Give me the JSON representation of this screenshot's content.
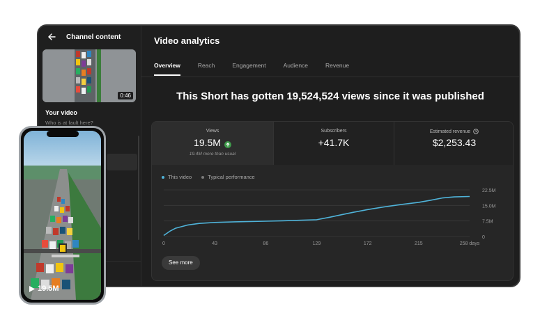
{
  "sidebar": {
    "title": "Channel content",
    "thumbnail_duration": "0:46",
    "your_video_label": "Your video",
    "video_title": "Who is at fault here?"
  },
  "main": {
    "title": "Video analytics",
    "tabs": [
      {
        "label": "Overview",
        "active": true
      },
      {
        "label": "Reach",
        "active": false
      },
      {
        "label": "Engagement",
        "active": false
      },
      {
        "label": "Audience",
        "active": false
      },
      {
        "label": "Revenue",
        "active": false
      }
    ],
    "headline": "This Short has gotten 19,524,524 views since it was published",
    "cards": {
      "views": {
        "label": "Views",
        "value": "19.5M",
        "note": "19.4M more than usual"
      },
      "subscribers": {
        "label": "Subscribers",
        "value": "+41.7K"
      },
      "revenue": {
        "label": "Estimated revenue",
        "value": "$2,253.43"
      }
    },
    "see_more_label": "See more"
  },
  "phone": {
    "views_label": "19.5M"
  },
  "colors": {
    "accent_line": "#4fb3d9",
    "typical_line": "#7a7a7a",
    "up_badge": "#3f9b4b"
  },
  "chart_data": {
    "type": "line",
    "series": [
      {
        "name": "This video",
        "x": [
          0,
          5,
          10,
          20,
          30,
          43,
          60,
          86,
          100,
          129,
          140,
          150,
          160,
          172,
          185,
          200,
          215,
          225,
          235,
          245,
          258
        ],
        "y": [
          0.5,
          2.5,
          4.0,
          5.5,
          6.3,
          6.8,
          7.1,
          7.4,
          7.6,
          8.1,
          9.3,
          10.5,
          11.7,
          13.0,
          14.2,
          15.4,
          16.5,
          17.5,
          18.6,
          19.1,
          19.3
        ]
      }
    ],
    "legend": [
      "This video",
      "Typical performance"
    ],
    "xticks": [
      "0",
      "43",
      "86",
      "129",
      "172",
      "215",
      "258 days"
    ],
    "xtick_values": [
      0,
      43,
      86,
      129,
      172,
      215,
      258
    ],
    "yticks": [
      "0",
      "7.5M",
      "15.0M",
      "22.5M"
    ],
    "ytick_values": [
      0,
      7.5,
      15.0,
      22.5
    ],
    "xlim": [
      0,
      258
    ],
    "ylim": [
      0,
      22.5
    ],
    "grid": true,
    "y_axis_side": "right"
  }
}
